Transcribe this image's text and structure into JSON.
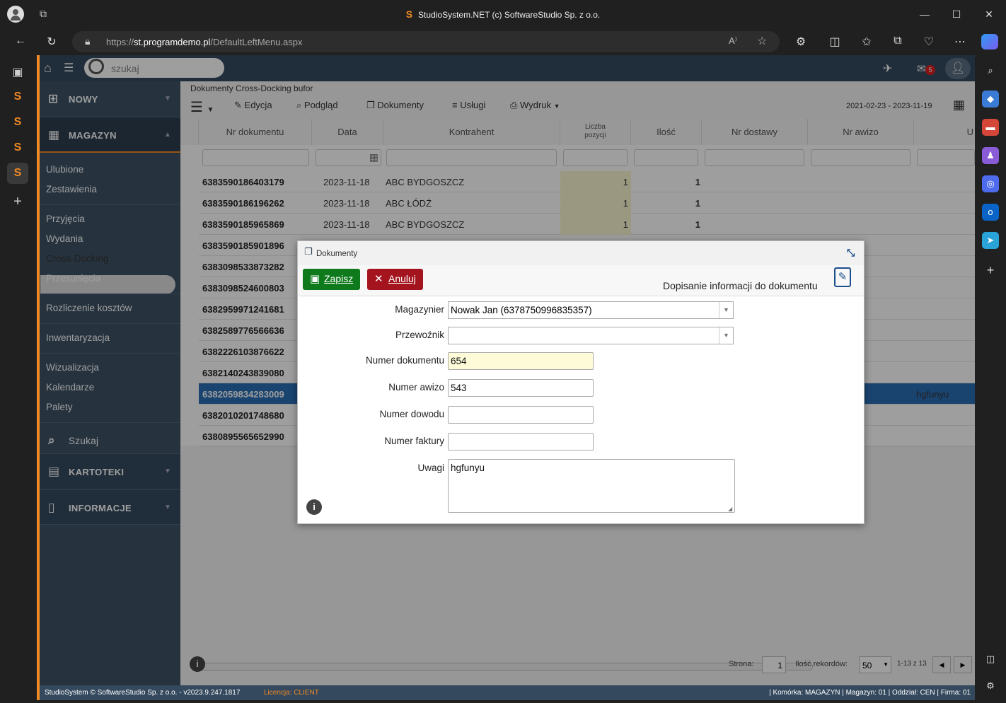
{
  "browser": {
    "title": "StudioSystem.NET (c) SoftwareStudio Sp. z o.o.",
    "url_scheme": "https://",
    "url_host": "st.programdemo.pl",
    "url_path": "/DefaultLeftMenu.aspx"
  },
  "app": {
    "search_placeholder": "szukaj",
    "mail_count": "5"
  },
  "menu": {
    "nowy": "NOWY",
    "magazyn": "MAGAZYN",
    "items": [
      "Ulubione",
      "Zestawienia",
      "Przyjęcia",
      "Wydania",
      "Cross-Docking",
      "Przesunięcia",
      "Rozliczenie kosztów",
      "Inwentaryzacja",
      "Wizualizacja",
      "Kalendarze",
      "Palety"
    ],
    "szukaj": "Szukaj",
    "kartoteki": "KARTOTEKI",
    "informacje": "INFORMACJE"
  },
  "main": {
    "breadcrumb": "Dokumenty Cross-Docking bufor",
    "toolbar": {
      "edycja": "Edycja",
      "podglad": "Podgląd",
      "dokumenty": "Dokumenty",
      "uslugi": "Usługi",
      "wydruk": "Wydruk",
      "date_range": "2021-02-23 - 2023-11-19"
    },
    "columns": [
      "Nr dokumentu",
      "Data",
      "Kontrahent",
      "Liczba pozycji",
      "Ilość",
      "Nr dostawy",
      "Nr awizo",
      "U"
    ],
    "rows": [
      {
        "nr": "6383590186403179",
        "data": "2023-11-18",
        "kontrahent": "ABC BYDGOSZCZ",
        "liczba": "1",
        "ilosc": "1",
        "uwagi": ""
      },
      {
        "nr": "6383590186196262",
        "data": "2023-11-18",
        "kontrahent": "ABC ŁÓDŹ",
        "liczba": "1",
        "ilosc": "1",
        "uwagi": ""
      },
      {
        "nr": "6383590185965869",
        "data": "2023-11-18",
        "kontrahent": "ABC BYDGOSZCZ",
        "liczba": "1",
        "ilosc": "1",
        "uwagi": ""
      },
      {
        "nr": "6383590185901896",
        "data": "",
        "kontrahent": "",
        "liczba": "",
        "ilosc": "",
        "uwagi": ""
      },
      {
        "nr": "6383098533873282",
        "data": "",
        "kontrahent": "",
        "liczba": "",
        "ilosc": "",
        "uwagi": ""
      },
      {
        "nr": "6383098524600803",
        "data": "",
        "kontrahent": "",
        "liczba": "",
        "ilosc": "",
        "uwagi": ""
      },
      {
        "nr": "6382959971241681",
        "data": "",
        "kontrahent": "",
        "liczba": "",
        "ilosc": "",
        "uwagi": ""
      },
      {
        "nr": "6382589776566636",
        "data": "",
        "kontrahent": "",
        "liczba": "",
        "ilosc": "",
        "uwagi": ""
      },
      {
        "nr": "6382226103876622",
        "data": "",
        "kontrahent": "",
        "liczba": "",
        "ilosc": "",
        "uwagi": ""
      },
      {
        "nr": "6382140243839080",
        "data": "",
        "kontrahent": "",
        "liczba": "",
        "ilosc": "",
        "uwagi": ""
      },
      {
        "nr": "6382059834283009",
        "data": "",
        "kontrahent": "",
        "liczba": "",
        "ilosc": "",
        "uwagi": "hgfunyu"
      },
      {
        "nr": "6382010201748680",
        "data": "",
        "kontrahent": "",
        "liczba": "",
        "ilosc": "",
        "uwagi": ""
      },
      {
        "nr": "6380895565652990",
        "data": "",
        "kontrahent": "",
        "liczba": "",
        "ilosc": "",
        "uwagi": ""
      }
    ],
    "pager": {
      "strona_label": "Strona:",
      "strona": "1",
      "ilosc_label": "Ilość rekordów:",
      "ilosc": "50",
      "range": "1-13 z 13"
    }
  },
  "footer": {
    "copyright": "StudioSystem © SoftwareStudio Sp. z o.o. - v2023.9.247.1817",
    "licencja_label": "Licencja:",
    "licencja": "CLIENT",
    "right": "| Komórka: MAGAZYN | Magazyn: 01 | Oddział: CEN | Firma: 01"
  },
  "dialog": {
    "title": "Dokumenty",
    "save": "Zapisz",
    "cancel": "Anuluj",
    "subtitle": "Dopisanie informacji do dokumentu",
    "fields": {
      "magazynier_label": "Magazynier",
      "magazynier": "Nowak Jan (6378750996835357)",
      "przewoznik_label": "Przewoźnik",
      "przewoznik": "",
      "numer_dokumentu_label": "Numer dokumentu",
      "numer_dokumentu": "654",
      "numer_awizo_label": "Numer awizo",
      "numer_awizo": "543",
      "numer_dowodu_label": "Numer dowodu",
      "numer_dowodu": "",
      "numer_faktury_label": "Numer faktury",
      "numer_faktury": "",
      "uwagi_label": "Uwagi",
      "uwagi": "hgfunyu"
    }
  },
  "colors": {
    "accent": "#f08a24",
    "nav": "#34495e",
    "save": "#0f7a1c",
    "cancel": "#a3141e"
  }
}
